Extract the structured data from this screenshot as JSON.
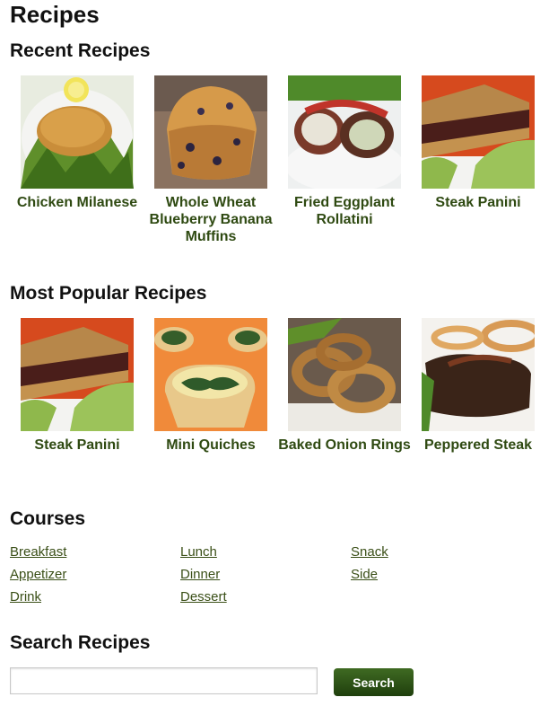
{
  "page": {
    "title": "Recipes"
  },
  "recent": {
    "heading": "Recent Recipes",
    "items": [
      {
        "label": "Chicken Milanese",
        "image": "chicken-milanese-photo"
      },
      {
        "label": "Whole Wheat Blueberry Banana Muffins",
        "image": "blueberry-muffin-photo"
      },
      {
        "label": "Fried Eggplant Rollatini",
        "image": "eggplant-rollatini-photo"
      },
      {
        "label": "Steak Panini",
        "image": "steak-panini-photo"
      }
    ]
  },
  "popular": {
    "heading": "Most Popular Recipes",
    "items": [
      {
        "label": "Steak Panini",
        "image": "steak-panini-photo"
      },
      {
        "label": "Mini Quiches",
        "image": "mini-quiches-photo"
      },
      {
        "label": "Baked Onion Rings",
        "image": "onion-rings-photo"
      },
      {
        "label": "Peppered Steak",
        "image": "peppered-steak-photo"
      }
    ]
  },
  "courses": {
    "heading": "Courses",
    "links": [
      "Breakfast",
      "Lunch",
      "Snack",
      "Appetizer",
      "Dinner",
      "Side",
      "Drink",
      "Dessert"
    ]
  },
  "search": {
    "heading": "Search Recipes",
    "value": "",
    "placeholder": "",
    "button_label": "Search"
  },
  "colors": {
    "link_green": "#2f4a12",
    "button_green": "#2a4f15"
  }
}
